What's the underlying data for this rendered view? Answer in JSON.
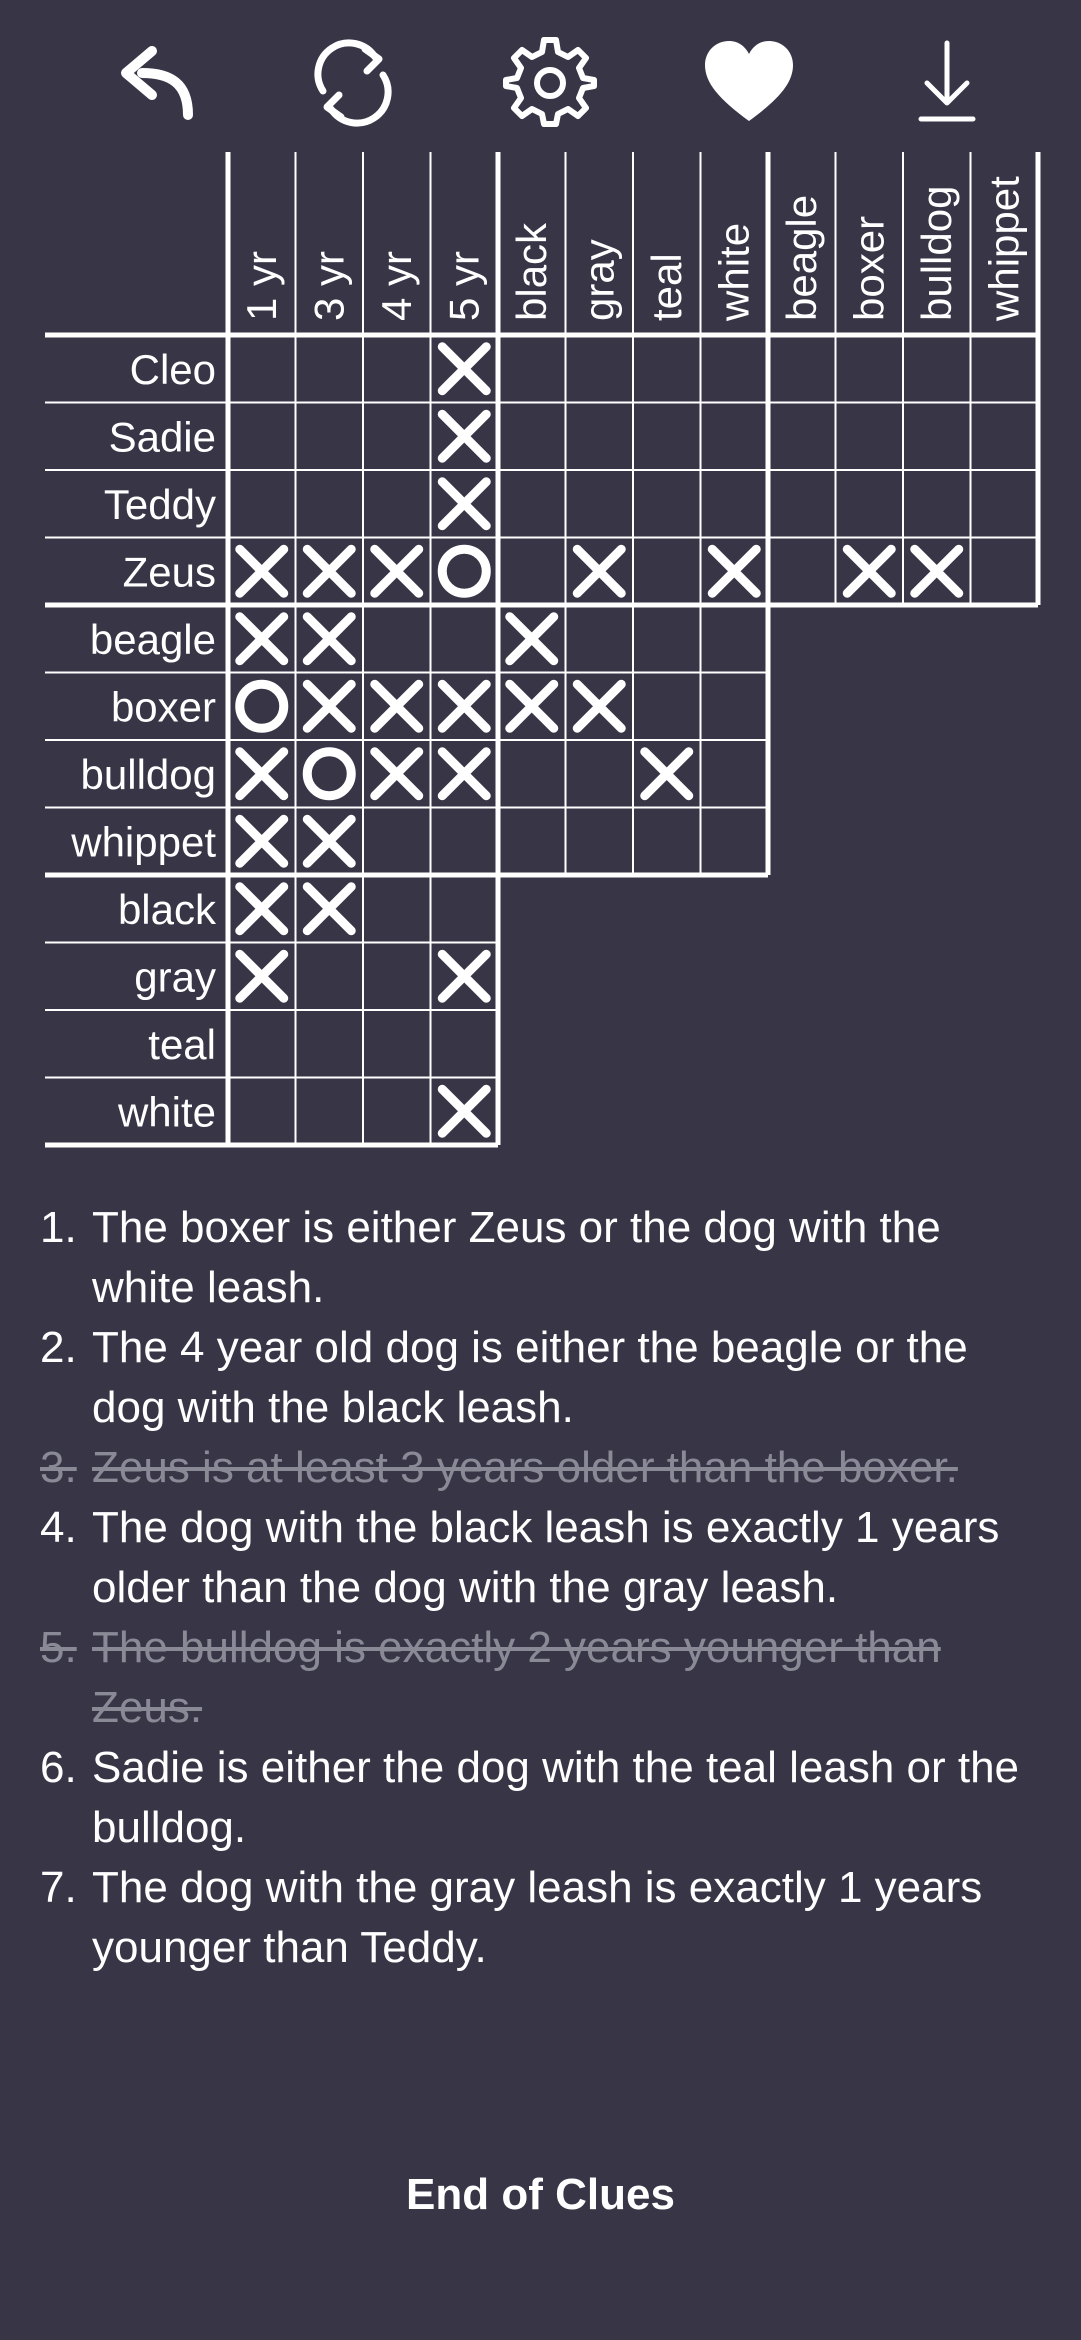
{
  "toolbar": {
    "icons": [
      "undo-icon",
      "reset-icon",
      "settings-icon",
      "heart-icon",
      "download-icon"
    ]
  },
  "grid": {
    "columns": [
      {
        "group": "age",
        "items": [
          "1 yr",
          "3 yr",
          "4 yr",
          "5 yr"
        ]
      },
      {
        "group": "leash",
        "items": [
          "black",
          "gray",
          "teal",
          "white"
        ]
      },
      {
        "group": "breed",
        "items": [
          "beagle",
          "boxer",
          "bulldog",
          "whippet"
        ]
      }
    ],
    "rows": [
      {
        "group": "name",
        "items": [
          "Cleo",
          "Sadie",
          "Teddy",
          "Zeus"
        ]
      },
      {
        "group": "breed",
        "items": [
          "beagle",
          "boxer",
          "bulldog",
          "whippet"
        ]
      },
      {
        "group": "leash",
        "items": [
          "black",
          "gray",
          "teal",
          "white"
        ]
      }
    ],
    "marks": [
      {
        "block": "name-age",
        "cells": [
          [
            "",
            "",
            "",
            "X"
          ],
          [
            "",
            "",
            "",
            "X"
          ],
          [
            "",
            "",
            "",
            "X"
          ],
          [
            "X",
            "X",
            "X",
            "O"
          ]
        ]
      },
      {
        "block": "name-leash",
        "cells": [
          [
            "",
            "",
            "",
            ""
          ],
          [
            "",
            "",
            "",
            ""
          ],
          [
            "",
            "",
            "",
            ""
          ],
          [
            "",
            "X",
            "",
            "X"
          ]
        ]
      },
      {
        "block": "name-breed",
        "cells": [
          [
            "",
            "",
            "",
            ""
          ],
          [
            "",
            "",
            "",
            ""
          ],
          [
            "",
            "",
            "",
            ""
          ],
          [
            "",
            "X",
            "X",
            ""
          ]
        ]
      },
      {
        "block": "breed-age",
        "cells": [
          [
            "X",
            "X",
            "",
            ""
          ],
          [
            "O",
            "X",
            "X",
            "X"
          ],
          [
            "X",
            "O",
            "X",
            "X"
          ],
          [
            "X",
            "X",
            "",
            ""
          ]
        ]
      },
      {
        "block": "breed-leash",
        "cells": [
          [
            "X",
            "",
            "",
            ""
          ],
          [
            "X",
            "X",
            "",
            ""
          ],
          [
            "",
            "",
            "X",
            ""
          ],
          [
            "",
            "",
            "",
            ""
          ]
        ]
      },
      {
        "block": "leash-age",
        "cells": [
          [
            "X",
            "X",
            "",
            ""
          ],
          [
            "X",
            "",
            "",
            "X"
          ],
          [
            "",
            "",
            "",
            ""
          ],
          [
            "",
            "",
            "",
            "X"
          ]
        ]
      }
    ]
  },
  "clues": [
    {
      "num": "1.",
      "text": "The boxer is either Zeus or the dog with the white leash.",
      "done": false
    },
    {
      "num": "2.",
      "text": "The 4 year old dog is either the beagle or the dog with the black leash.",
      "done": false
    },
    {
      "num": "3.",
      "text": "Zeus is at least 3 years older than the boxer.",
      "done": true
    },
    {
      "num": "4.",
      "text": "The dog with the black leash is exactly 1 years older than the dog with the gray leash.",
      "done": false
    },
    {
      "num": "5.",
      "text": "The bulldog is exactly 2 years younger than Zeus.",
      "done": true
    },
    {
      "num": "6.",
      "text": "Sadie is either the dog with the teal leash or the bulldog.",
      "done": false
    },
    {
      "num": "7.",
      "text": "The dog with the gray leash is exactly 1 years younger than Teddy.",
      "done": false
    }
  ],
  "end_label": "End of Clues"
}
